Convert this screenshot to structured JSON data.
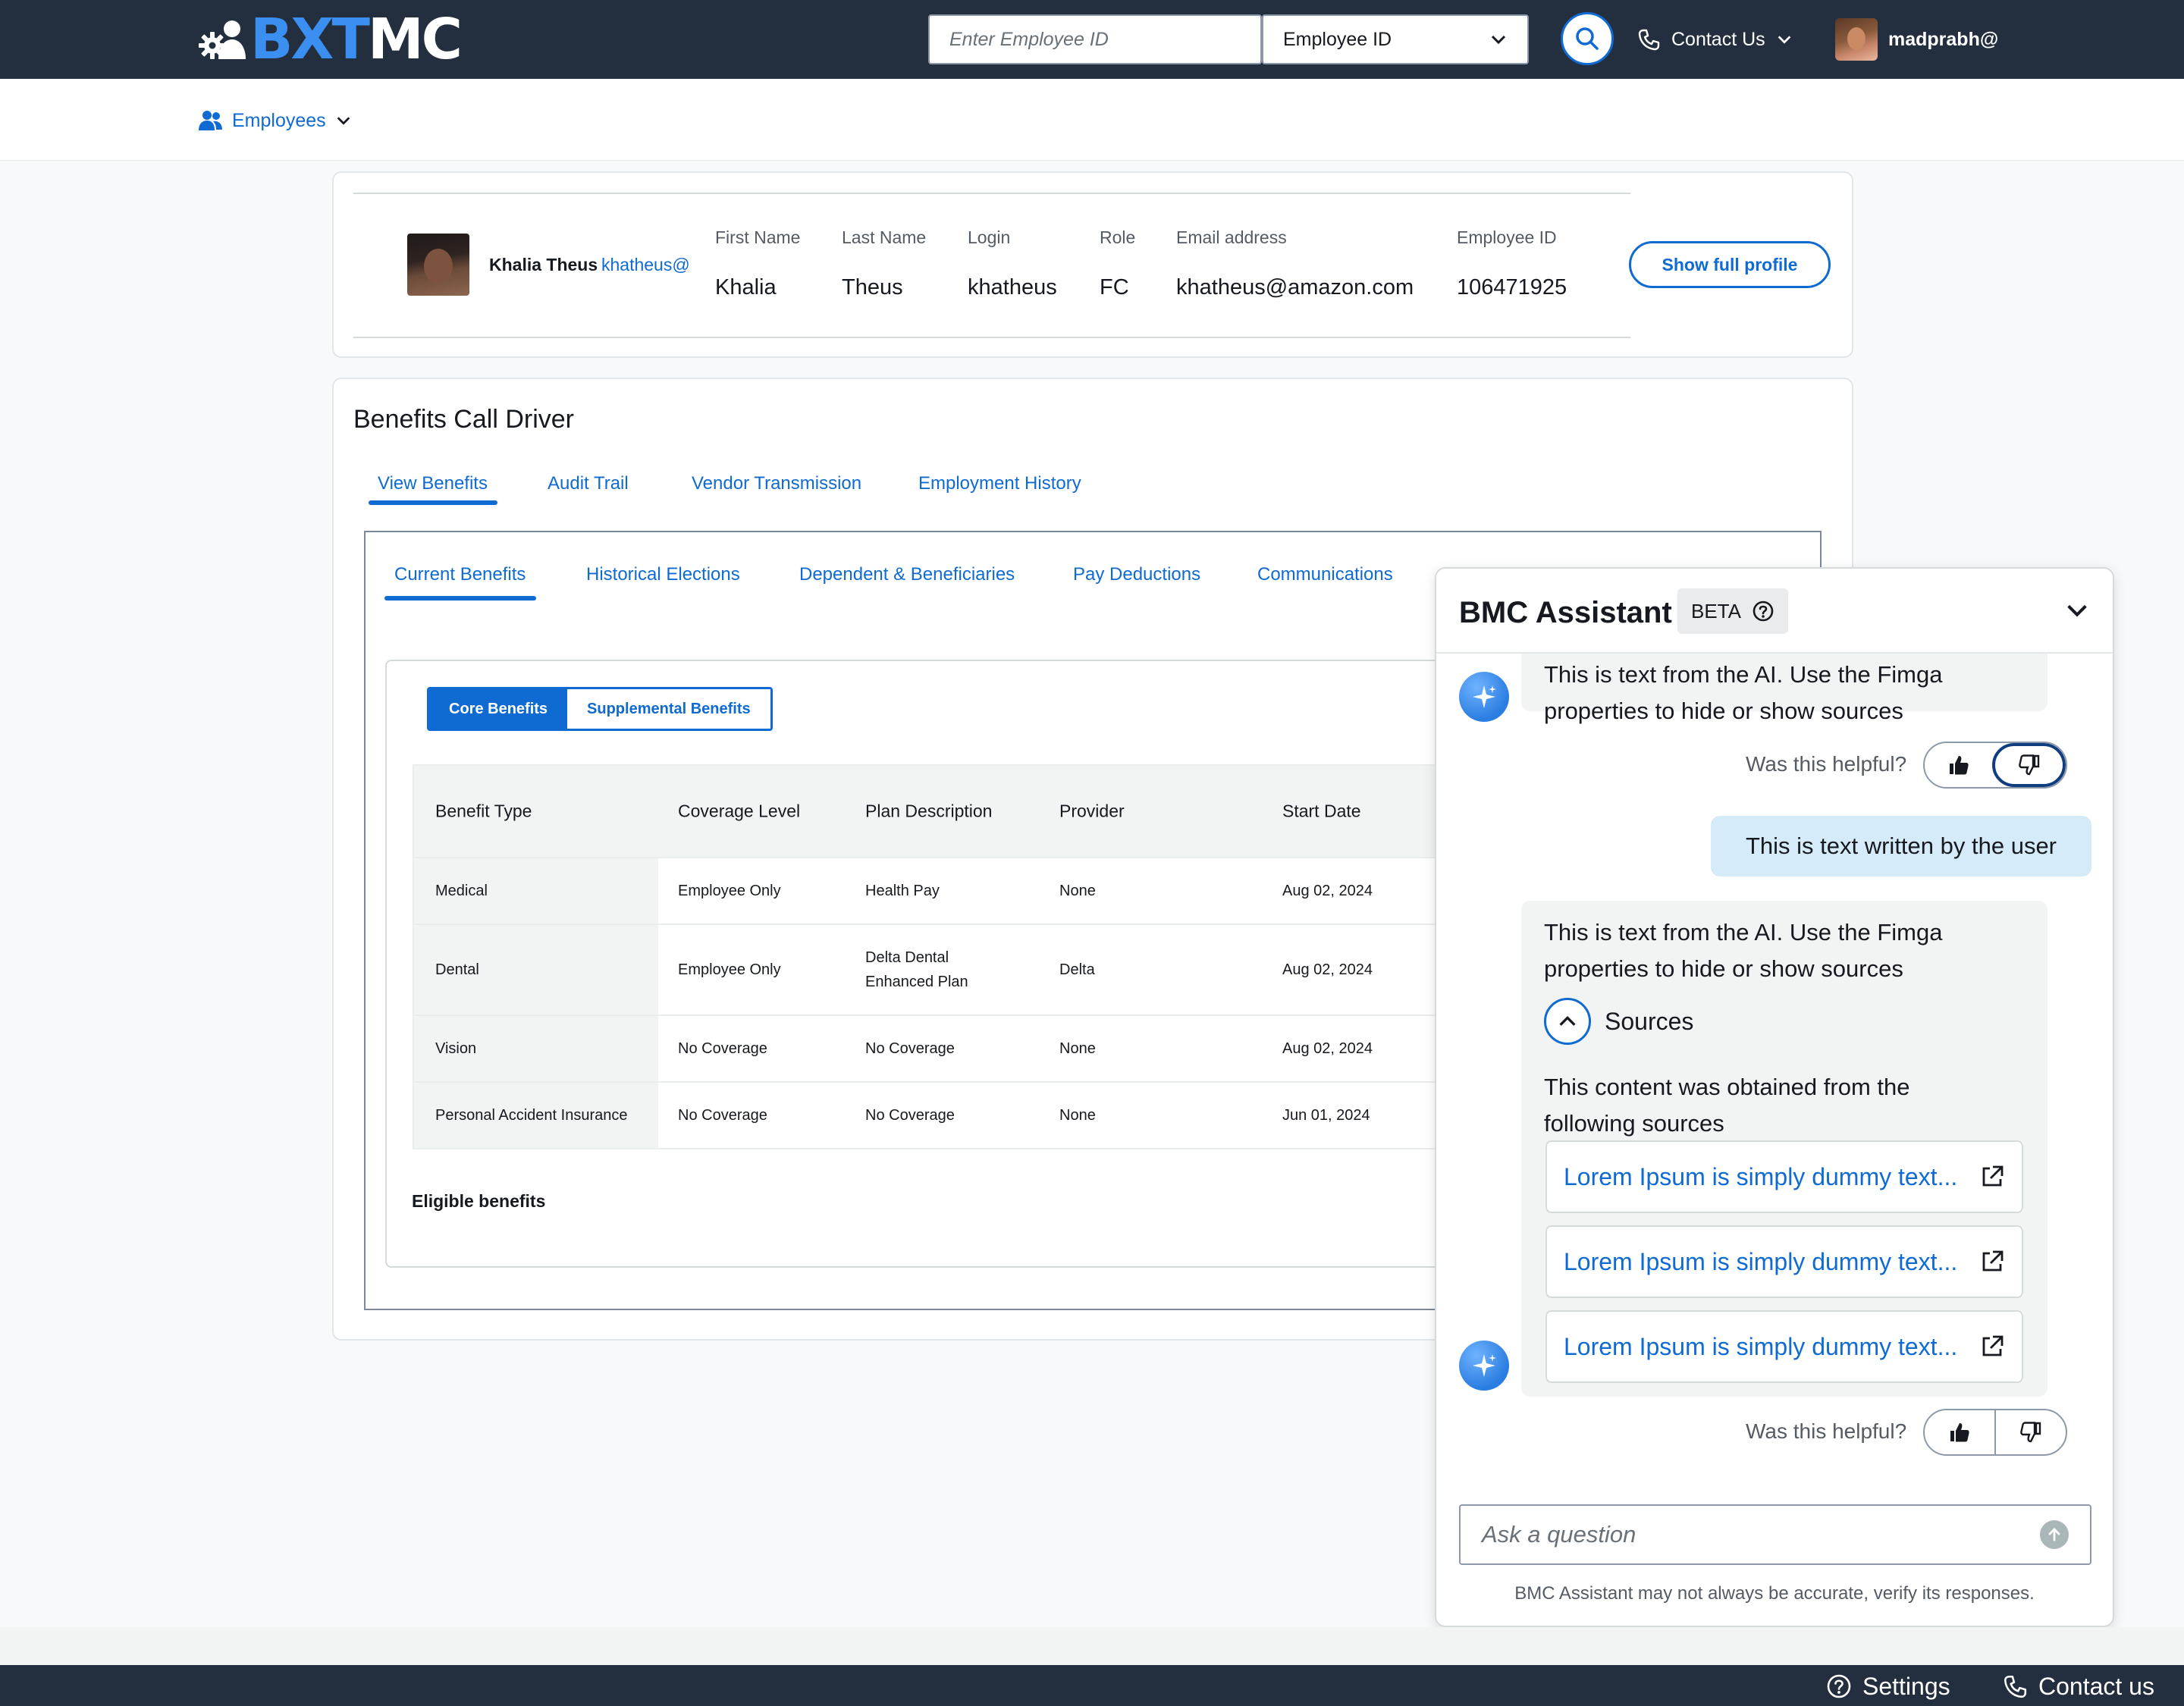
{
  "header": {
    "logo_bx": "BXT",
    "logo_mc": "MC",
    "search_placeholder": "Enter Employee ID",
    "search_type": "Employee ID",
    "contact_label": "Contact Us",
    "username": "madprabh@"
  },
  "subnav": {
    "employees_label": "Employees"
  },
  "profile": {
    "name": "Khalia Theus",
    "login_link": "khatheus@",
    "fields": [
      {
        "label": "First Name",
        "value": "Khalia"
      },
      {
        "label": "Last Name",
        "value": "Theus"
      },
      {
        "label": "Login",
        "value": "khatheus"
      },
      {
        "label": "Role",
        "value": "FC"
      },
      {
        "label": "Email address",
        "value": "khatheus@amazon.com"
      },
      {
        "label": "Employee ID",
        "value": "106471925"
      }
    ],
    "show_full_profile": "Show full profile"
  },
  "benefits": {
    "title": "Benefits Call Driver",
    "tabs": [
      "View Benefits",
      "Audit Trail",
      "Vendor Transmission",
      "Employment History"
    ],
    "active_tab": "View Benefits",
    "subtabs": [
      "Current Benefits",
      "Historical Elections",
      "Dependent & Beneficiaries",
      "Pay Deductions",
      "Communications"
    ],
    "active_subtab": "Current Benefits",
    "segments": [
      "Core Benefits",
      "Supplemental Benefits"
    ],
    "active_segment": "Core Benefits",
    "table": {
      "headers": [
        "Benefit Type",
        "Coverage Level",
        "Plan Description",
        "Provider",
        "Start Date"
      ],
      "rows": [
        [
          "Medical",
          "Employee Only",
          "Health Pay",
          "None",
          "Aug 02, 2024"
        ],
        [
          "Dental",
          "Employee Only",
          "Delta Dental Enhanced Plan",
          "Delta",
          "Aug 02, 2024"
        ],
        [
          "Vision",
          "No Coverage",
          "No Coverage",
          "None",
          "Aug 02, 2024"
        ],
        [
          "Personal Accident Insurance",
          "No Coverage",
          "No Coverage",
          "None",
          "Jun 01, 2024"
        ]
      ]
    },
    "eligible_label": "Eligible benefits"
  },
  "assistant": {
    "title": "BMC Assistant",
    "badge": "BETA",
    "messages": {
      "ai_1": "This is text from the AI. Use the Fimga properties to hide or show sources",
      "user_1": "This is text written by the user",
      "ai_2": "This is text from the AI. Use the Fimga properties to hide or show sources",
      "sources_label": "Sources",
      "sources_intro": "This content was obtained from the following sources",
      "sources": [
        "Lorem Ipsum is simply dummy text...",
        "Lorem Ipsum is simply dummy text...",
        "Lorem Ipsum is simply dummy text..."
      ]
    },
    "helpful_label": "Was this helpful?",
    "ask_placeholder": "Ask a question",
    "disclaimer": "BMC Assistant may not always be accurate, verify its responses."
  },
  "footer": {
    "settings_label": "Settings",
    "contact_label": "Contact us"
  },
  "colors": {
    "header_bg": "#232f3e",
    "accent": "#0f6bd1",
    "logo_blue": "#3b8ff0",
    "user_bubble": "#d6ebfa"
  }
}
